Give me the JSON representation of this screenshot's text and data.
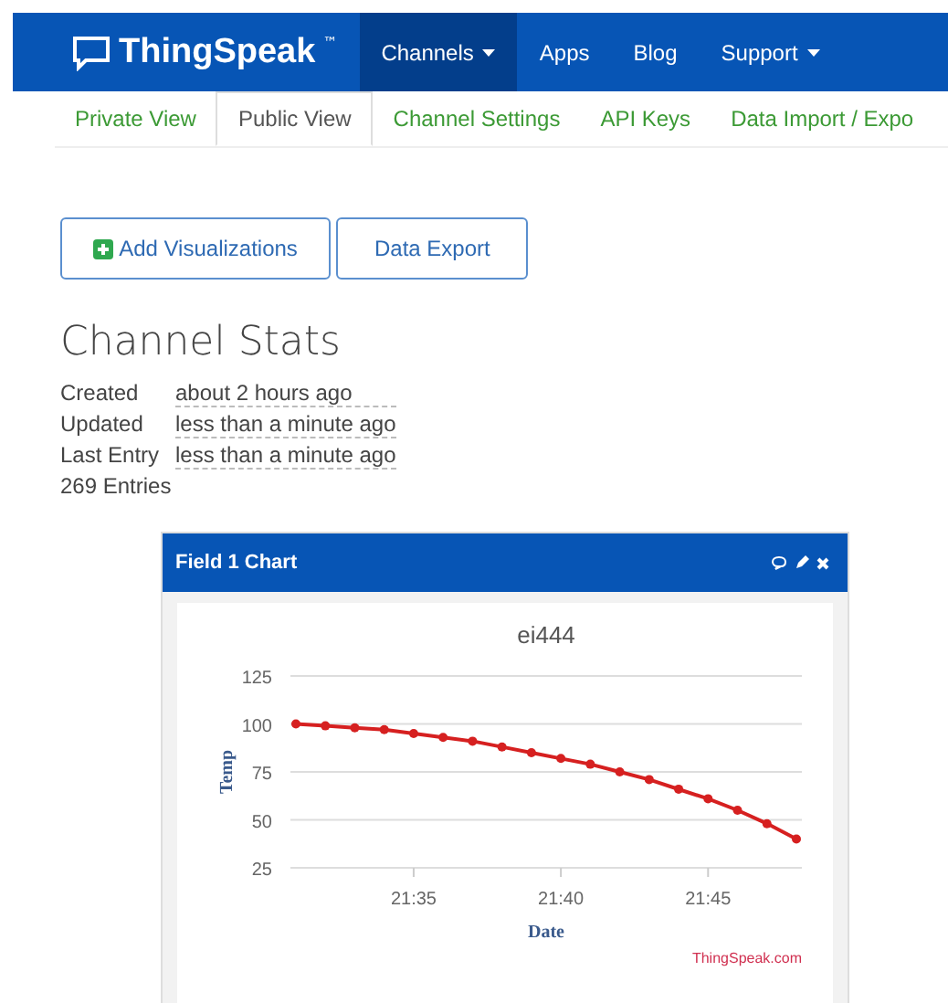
{
  "navbar": {
    "brand": "ThingSpeak",
    "trademark": "™",
    "items": [
      {
        "label": "Channels",
        "dropdown": true,
        "selected": true
      },
      {
        "label": "Apps",
        "dropdown": false,
        "selected": false
      },
      {
        "label": "Blog",
        "dropdown": false,
        "selected": false
      },
      {
        "label": "Support",
        "dropdown": true,
        "selected": false
      }
    ]
  },
  "tabs": [
    {
      "label": "Private View",
      "selected": false
    },
    {
      "label": "Public View",
      "selected": true
    },
    {
      "label": "Channel Settings",
      "selected": false
    },
    {
      "label": "API Keys",
      "selected": false
    },
    {
      "label": "Data Import / Expo",
      "selected": false
    }
  ],
  "buttons": [
    {
      "label": "Add Visualizations",
      "kind": "add"
    },
    {
      "label": "Data Export",
      "kind": "plain"
    }
  ],
  "stats": {
    "title": "Channel Stats",
    "rows": [
      {
        "label": "Created",
        "value": "about 2 hours ago"
      },
      {
        "label": "Updated",
        "value": "less than a minute ago"
      },
      {
        "label": "Last Entry",
        "value": "less than a minute ago"
      }
    ],
    "entries": "269 Entries"
  },
  "panel": {
    "title": "Field 1 Chart",
    "credit": "ThingSpeak.com",
    "chart_data": {
      "type": "line",
      "title": "ei444",
      "xlabel": "Date",
      "ylabel": "Temp",
      "categories": [
        null,
        null,
        null,
        null,
        "21:35",
        null,
        null,
        null,
        null,
        "21:40",
        null,
        null,
        null,
        null,
        "21:45",
        null,
        null,
        null
      ],
      "series": [
        {
          "color": "#d62020",
          "marker": "circle",
          "values": [
            100,
            99,
            98,
            97,
            95,
            93,
            91,
            88,
            85,
            82,
            79,
            75,
            71,
            66,
            61,
            55,
            48,
            40
          ]
        }
      ],
      "grid": true,
      "ylim": [
        25,
        125
      ],
      "yticks": [
        25,
        50,
        75,
        100,
        125
      ]
    }
  }
}
